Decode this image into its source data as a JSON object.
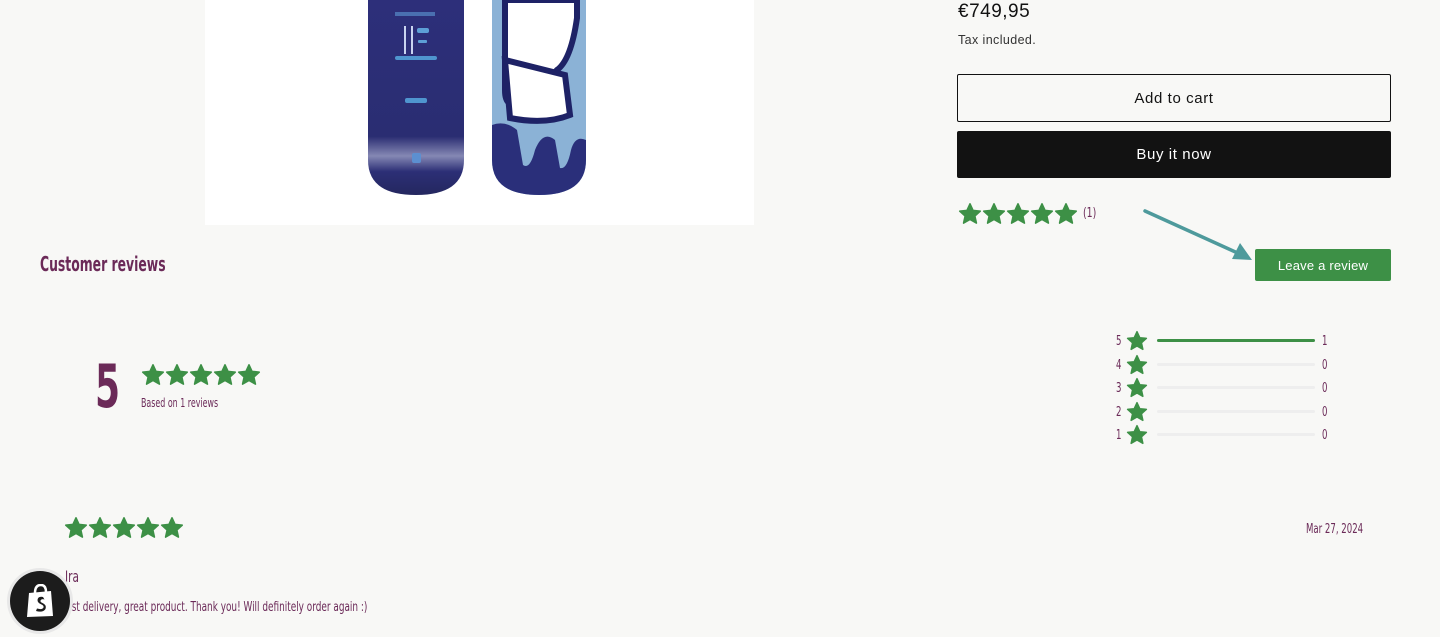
{
  "product": {
    "price": "€749,95",
    "tax_note": "Tax included.",
    "add_to_cart_label": "Add to cart",
    "buy_now_label": "Buy it now",
    "rating_summary_count": "(1)",
    "rating_summary_stars": 5
  },
  "reviews": {
    "title": "Customer reviews",
    "leave_review_label": "Leave a review",
    "average": "5",
    "average_stars": 5,
    "based_on": "Based on 1 reviews",
    "histogram": [
      {
        "stars": "5",
        "count": "1",
        "fill": 1.0
      },
      {
        "stars": "4",
        "count": "0",
        "fill": 0
      },
      {
        "stars": "3",
        "count": "0",
        "fill": 0
      },
      {
        "stars": "2",
        "count": "0",
        "fill": 0
      },
      {
        "stars": "1",
        "count": "0",
        "fill": 0
      }
    ],
    "items": [
      {
        "stars": 5,
        "date": "Mar 27, 2024",
        "author": "Ira",
        "body": "Fast delivery, great product. Thank you! Will definitely order again :)"
      }
    ]
  },
  "colors": {
    "accent_green": "#3d9046",
    "heading_plum": "#6b2a58",
    "button_dark": "#121212",
    "arrow_teal": "#4e9a9c"
  },
  "icons": {
    "star": "star-icon",
    "arrow": "arrow-annotation",
    "badge": "shopify-bag-icon"
  }
}
